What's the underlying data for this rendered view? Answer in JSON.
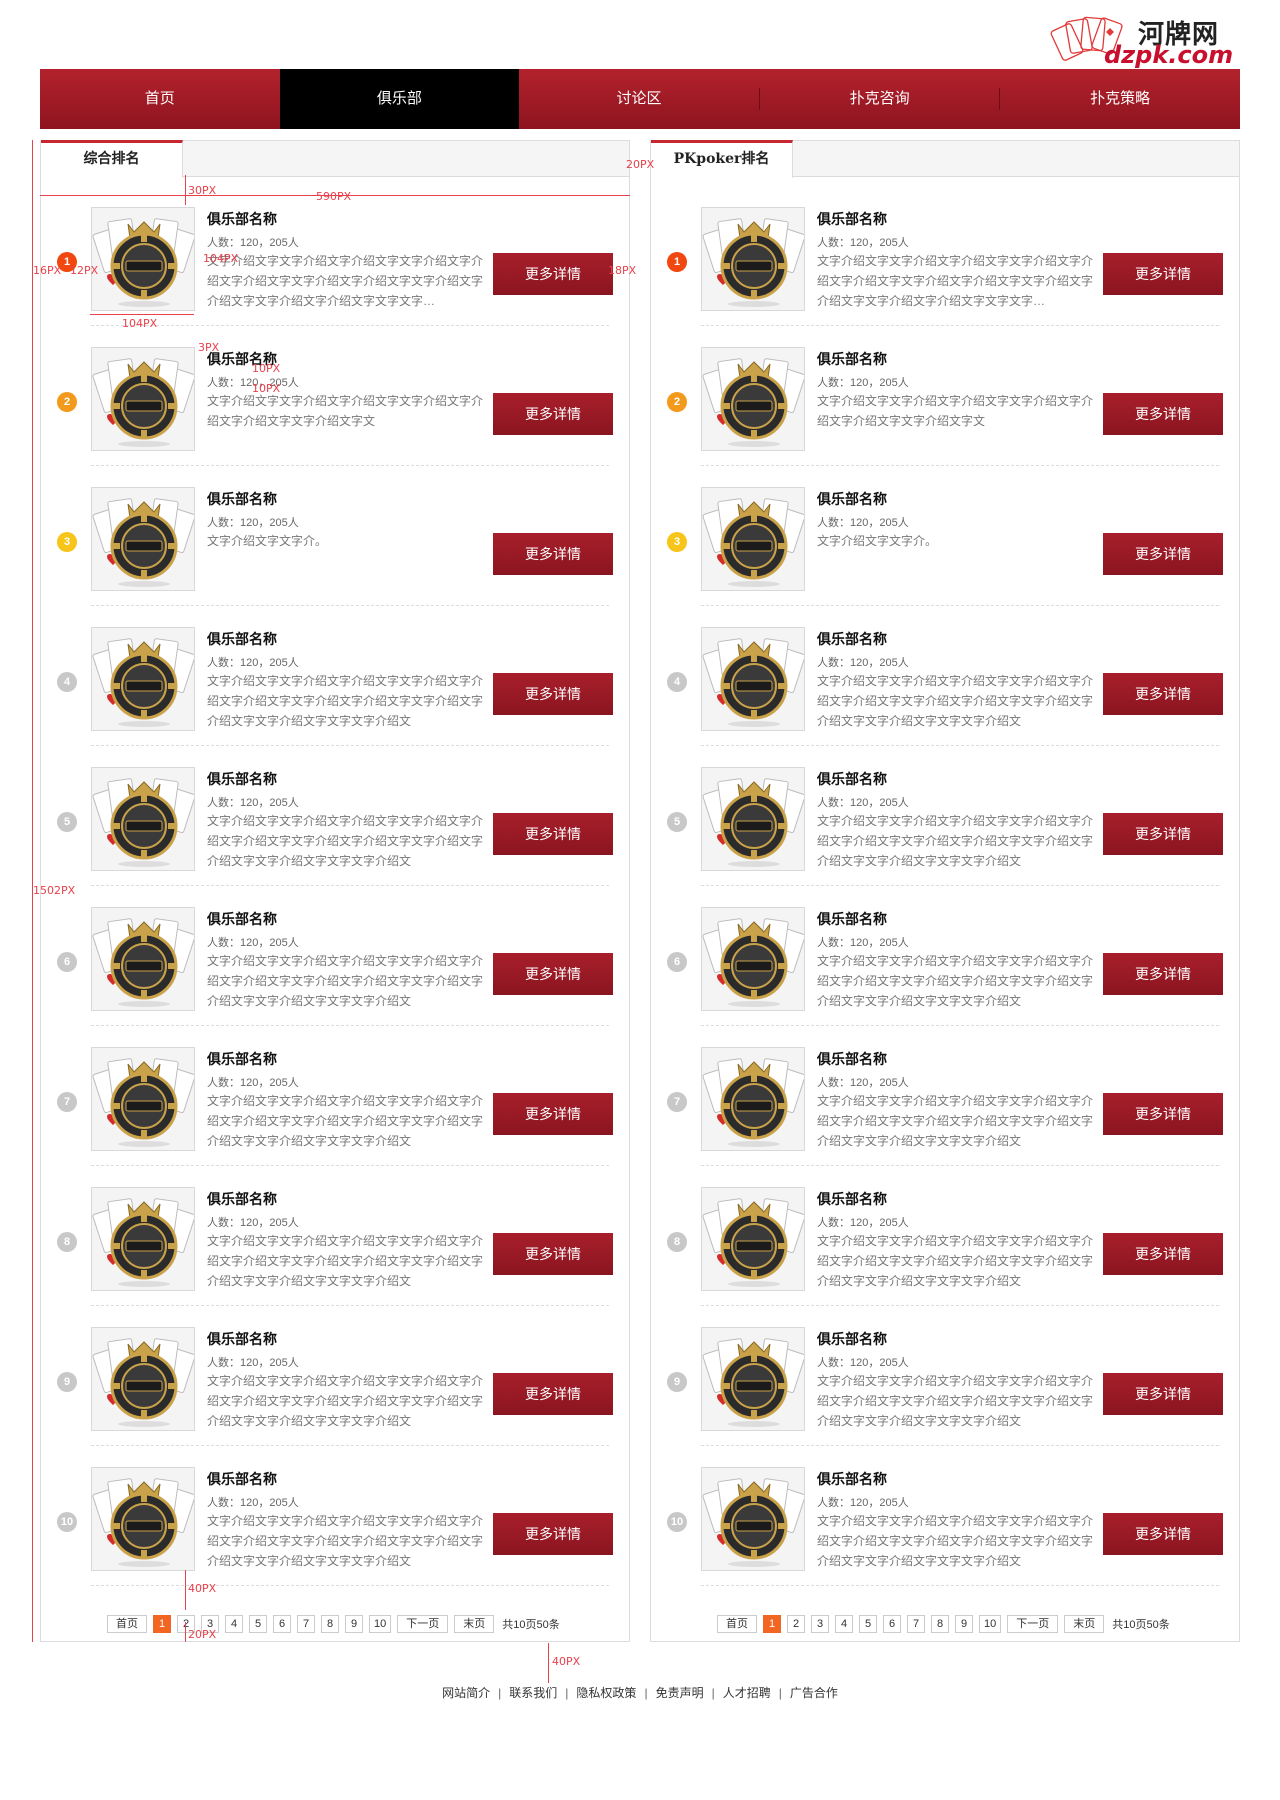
{
  "logo": {
    "title_cn": "河牌网",
    "title_en": "dzpk.com"
  },
  "nav": {
    "items": [
      {
        "label": "首页",
        "active": false
      },
      {
        "label": "俱乐部",
        "active": true
      },
      {
        "label": "讨论区",
        "active": false
      },
      {
        "label": "扑克咨询",
        "active": false
      },
      {
        "label": "扑克策略",
        "active": false
      }
    ]
  },
  "columns": [
    {
      "tab": "综合排名",
      "items": [
        {
          "rank": "1",
          "name": "俱乐部名称",
          "members": "人数：120，205人",
          "desc": "文字介绍文字文字介绍文字介绍文字文字介绍文字介绍文字介绍文字文字介绍文字介绍文字文字介绍文字介绍文字文字介绍文字介绍文字文字文字…",
          "button": "更多详情"
        },
        {
          "rank": "2",
          "name": "俱乐部名称",
          "members": "人数：120，205人",
          "desc": "文字介绍文字文字介绍文字介绍文字文字介绍文字介绍文字介绍文字文字介绍文字文",
          "button": "更多详情"
        },
        {
          "rank": "3",
          "name": "俱乐部名称",
          "members": "人数：120，205人",
          "desc": "文字介绍文字文字介。",
          "button": "更多详情"
        },
        {
          "rank": "4",
          "name": "俱乐部名称",
          "members": "人数：120，205人",
          "desc": "文字介绍文字文字介绍文字介绍文字文字介绍文字介绍文字介绍文字文字介绍文字介绍文字文字介绍文字介绍文字文字介绍文字文字文字介绍文",
          "button": "更多详情"
        },
        {
          "rank": "5",
          "name": "俱乐部名称",
          "members": "人数：120，205人",
          "desc": "文字介绍文字文字介绍文字介绍文字文字介绍文字介绍文字介绍文字文字介绍文字介绍文字文字介绍文字介绍文字文字介绍文字文字文字介绍文",
          "button": "更多详情"
        },
        {
          "rank": "6",
          "name": "俱乐部名称",
          "members": "人数：120，205人",
          "desc": "文字介绍文字文字介绍文字介绍文字文字介绍文字介绍文字介绍文字文字介绍文字介绍文字文字介绍文字介绍文字文字介绍文字文字文字介绍文",
          "button": "更多详情"
        },
        {
          "rank": "7",
          "name": "俱乐部名称",
          "members": "人数：120，205人",
          "desc": "文字介绍文字文字介绍文字介绍文字文字介绍文字介绍文字介绍文字文字介绍文字介绍文字文字介绍文字介绍文字文字介绍文字文字文字介绍文",
          "button": "更多详情"
        },
        {
          "rank": "8",
          "name": "俱乐部名称",
          "members": "人数：120，205人",
          "desc": "文字介绍文字文字介绍文字介绍文字文字介绍文字介绍文字介绍文字文字介绍文字介绍文字文字介绍文字介绍文字文字介绍文字文字文字介绍文",
          "button": "更多详情"
        },
        {
          "rank": "9",
          "name": "俱乐部名称",
          "members": "人数：120，205人",
          "desc": "文字介绍文字文字介绍文字介绍文字文字介绍文字介绍文字介绍文字文字介绍文字介绍文字文字介绍文字介绍文字文字介绍文字文字文字介绍文",
          "button": "更多详情"
        },
        {
          "rank": "10",
          "name": "俱乐部名称",
          "members": "人数：120，205人",
          "desc": "文字介绍文字文字介绍文字介绍文字文字介绍文字介绍文字介绍文字文字介绍文字介绍文字文字介绍文字介绍文字文字介绍文字文字文字介绍文",
          "button": "更多详情"
        }
      ],
      "pager": {
        "first": "首页",
        "pages": [
          "1",
          "2",
          "3",
          "4",
          "5",
          "6",
          "7",
          "8",
          "9",
          "10"
        ],
        "current": "1",
        "next": "下一页",
        "last": "末页",
        "total": "共10页50条"
      }
    },
    {
      "tab": "PKpoker排名",
      "items": [
        {
          "rank": "1",
          "name": "俱乐部名称",
          "members": "人数：120，205人",
          "desc": "文字介绍文字文字介绍文字介绍文字文字介绍文字介绍文字介绍文字文字介绍文字介绍文字文字介绍文字介绍文字文字介绍文字介绍文字文字文字…",
          "button": "更多详情"
        },
        {
          "rank": "2",
          "name": "俱乐部名称",
          "members": "人数：120，205人",
          "desc": "文字介绍文字文字介绍文字介绍文字文字介绍文字介绍文字介绍文字文字介绍文字文",
          "button": "更多详情"
        },
        {
          "rank": "3",
          "name": "俱乐部名称",
          "members": "人数：120，205人",
          "desc": "文字介绍文字文字介。",
          "button": "更多详情"
        },
        {
          "rank": "4",
          "name": "俱乐部名称",
          "members": "人数：120，205人",
          "desc": "文字介绍文字文字介绍文字介绍文字文字介绍文字介绍文字介绍文字文字介绍文字介绍文字文字介绍文字介绍文字文字介绍文字文字文字介绍文",
          "button": "更多详情"
        },
        {
          "rank": "5",
          "name": "俱乐部名称",
          "members": "人数：120，205人",
          "desc": "文字介绍文字文字介绍文字介绍文字文字介绍文字介绍文字介绍文字文字介绍文字介绍文字文字介绍文字介绍文字文字介绍文字文字文字介绍文",
          "button": "更多详情"
        },
        {
          "rank": "6",
          "name": "俱乐部名称",
          "members": "人数：120，205人",
          "desc": "文字介绍文字文字介绍文字介绍文字文字介绍文字介绍文字介绍文字文字介绍文字介绍文字文字介绍文字介绍文字文字介绍文字文字文字介绍文",
          "button": "更多详情"
        },
        {
          "rank": "7",
          "name": "俱乐部名称",
          "members": "人数：120，205人",
          "desc": "文字介绍文字文字介绍文字介绍文字文字介绍文字介绍文字介绍文字文字介绍文字介绍文字文字介绍文字介绍文字文字介绍文字文字文字介绍文",
          "button": "更多详情"
        },
        {
          "rank": "8",
          "name": "俱乐部名称",
          "members": "人数：120，205人",
          "desc": "文字介绍文字文字介绍文字介绍文字文字介绍文字介绍文字介绍文字文字介绍文字介绍文字文字介绍文字介绍文字文字介绍文字文字文字介绍文",
          "button": "更多详情"
        },
        {
          "rank": "9",
          "name": "俱乐部名称",
          "members": "人数：120，205人",
          "desc": "文字介绍文字文字介绍文字介绍文字文字介绍文字介绍文字介绍文字文字介绍文字介绍文字文字介绍文字介绍文字文字介绍文字文字文字介绍文",
          "button": "更多详情"
        },
        {
          "rank": "10",
          "name": "俱乐部名称",
          "members": "人数：120，205人",
          "desc": "文字介绍文字文字介绍文字介绍文字文字介绍文字介绍文字介绍文字文字介绍文字介绍文字文字介绍文字介绍文字文字介绍文字文字文字介绍文",
          "button": "更多详情"
        }
      ],
      "pager": {
        "first": "首页",
        "pages": [
          "1",
          "2",
          "3",
          "4",
          "5",
          "6",
          "7",
          "8",
          "9",
          "10"
        ],
        "current": "1",
        "next": "下一页",
        "last": "末页",
        "total": "共10页50条"
      }
    }
  ],
  "rank_colors": {
    "1": "#f0480f",
    "2": "#f39a1d",
    "3": "#f7c41a",
    "other": "#c8c8c8"
  },
  "footer": {
    "links": [
      "网站简介",
      "联系我们",
      "隐私权政策",
      "免责声明",
      "人才招聘",
      "广告合作"
    ],
    "separator": "|"
  },
  "annotations": {
    "col_width": "590PX",
    "tab_gap": "30PX",
    "col_gap": "20PX",
    "thumb_h": "104PX",
    "thumb_w": "104PX",
    "rank_left": "16PX",
    "rank_gap": "12PX",
    "btn_right": "18PX",
    "name_gap": "3PX",
    "members_gap": "10PX",
    "desc_gap": "10PX",
    "col_height": "1502PX",
    "list_bottom": "40PX",
    "pager_bottom": "20PX",
    "footer_gap": "40PX"
  }
}
